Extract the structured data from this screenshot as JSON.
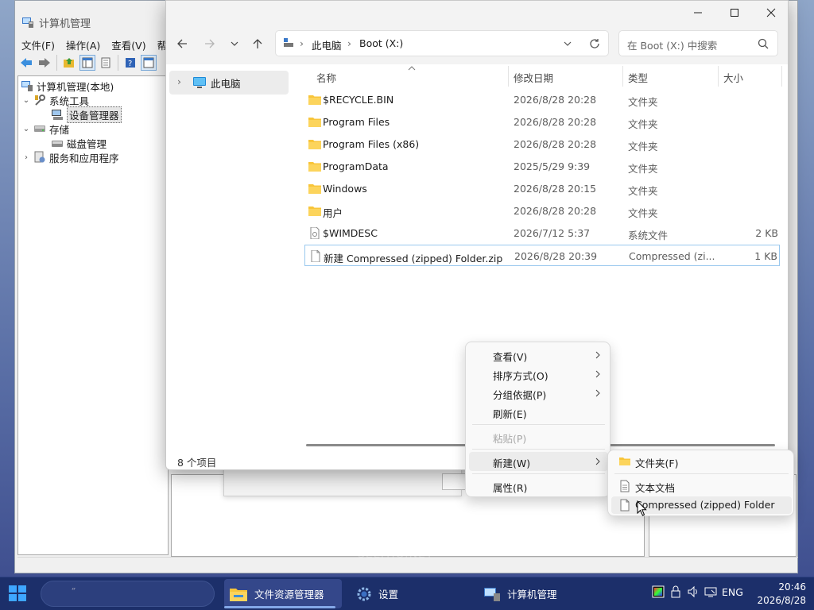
{
  "cm": {
    "title": "计算机管理",
    "menu": [
      "文件(F)",
      "操作(A)",
      "查看(V)",
      "帮"
    ],
    "tree": [
      {
        "label": "计算机管理(本地)",
        "icon": "computer-management-icon"
      },
      {
        "label": "系统工具",
        "icon": "system-tools-icon"
      },
      {
        "label": "设备管理器",
        "icon": "device-manager-icon",
        "selected": true
      },
      {
        "label": "存储",
        "icon": "storage-icon"
      },
      {
        "label": "磁盘管理",
        "icon": "disk-management-icon"
      },
      {
        "label": "服务和应用程序",
        "icon": "services-icon"
      }
    ]
  },
  "explorer": {
    "breadcrumb": [
      "此电脑",
      "Boot (X:)"
    ],
    "search_placeholder": "在 Boot (X:) 中搜索",
    "nav_item": "此电脑",
    "columns": {
      "name": "名称",
      "date": "修改日期",
      "type": "类型",
      "size": "大小"
    },
    "files": [
      {
        "name": "$RECYCLE.BIN",
        "date": "2026/8/28 20:28",
        "type": "文件夹",
        "size": "",
        "icon": "folder-icon"
      },
      {
        "name": "Program Files",
        "date": "2026/8/28 20:28",
        "type": "文件夹",
        "size": "",
        "icon": "folder-icon"
      },
      {
        "name": "Program Files (x86)",
        "date": "2026/8/28 20:28",
        "type": "文件夹",
        "size": "",
        "icon": "folder-icon"
      },
      {
        "name": "ProgramData",
        "date": "2025/5/29 9:39",
        "type": "文件夹",
        "size": "",
        "icon": "folder-icon"
      },
      {
        "name": "Windows",
        "date": "2026/8/28 20:15",
        "type": "文件夹",
        "size": "",
        "icon": "folder-icon"
      },
      {
        "name": "用户",
        "date": "2026/8/28 20:28",
        "type": "文件夹",
        "size": "",
        "icon": "folder-icon"
      },
      {
        "name": "$WIMDESC",
        "date": "2026/7/12 5:37",
        "type": "系统文件",
        "size": "2 KB",
        "icon": "system-file-icon"
      },
      {
        "name": "新建 Compressed (zipped) Folder.zip",
        "date": "2026/8/28 20:39",
        "type": "Compressed (zi...",
        "size": "1 KB",
        "icon": "file-icon",
        "selected": true
      }
    ],
    "status": "8 个项目"
  },
  "context_menu": {
    "items": [
      {
        "label": "查看(V)",
        "submenu": true
      },
      {
        "label": "排序方式(O)",
        "submenu": true
      },
      {
        "label": "分组依据(P)",
        "submenu": true
      },
      {
        "label": "刷新(E)",
        "submenu": false
      },
      {
        "label": "粘贴(P)",
        "disabled": true
      },
      {
        "label": "新建(W)",
        "submenu": true,
        "hover": true
      },
      {
        "label": "属性(R)",
        "submenu": false
      }
    ]
  },
  "new_submenu": {
    "items": [
      {
        "label": "文件夹(F)",
        "icon": "folder-icon"
      },
      {
        "label": "文本文档",
        "icon": "text-document-icon"
      },
      {
        "label": "Compressed (zipped) Folder",
        "icon": "file-icon",
        "hover": true
      }
    ]
  },
  "taskbar": {
    "apps": [
      {
        "label": "文件资源管理器",
        "icon": "file-explorer-icon",
        "active": true
      },
      {
        "label": "设置",
        "icon": "settings-gear-icon",
        "active": false
      },
      {
        "label": "计算机管理",
        "icon": "computer-management-icon",
        "active": false
      }
    ],
    "language": "ENG",
    "time": "20:46",
    "date": "2026/8/28"
  },
  "watermark": "SELTHO.NET",
  "colors": {
    "folder": "#f8c53a",
    "taskbar": "#1c2f6a",
    "selection_border": "#99c8ee"
  }
}
